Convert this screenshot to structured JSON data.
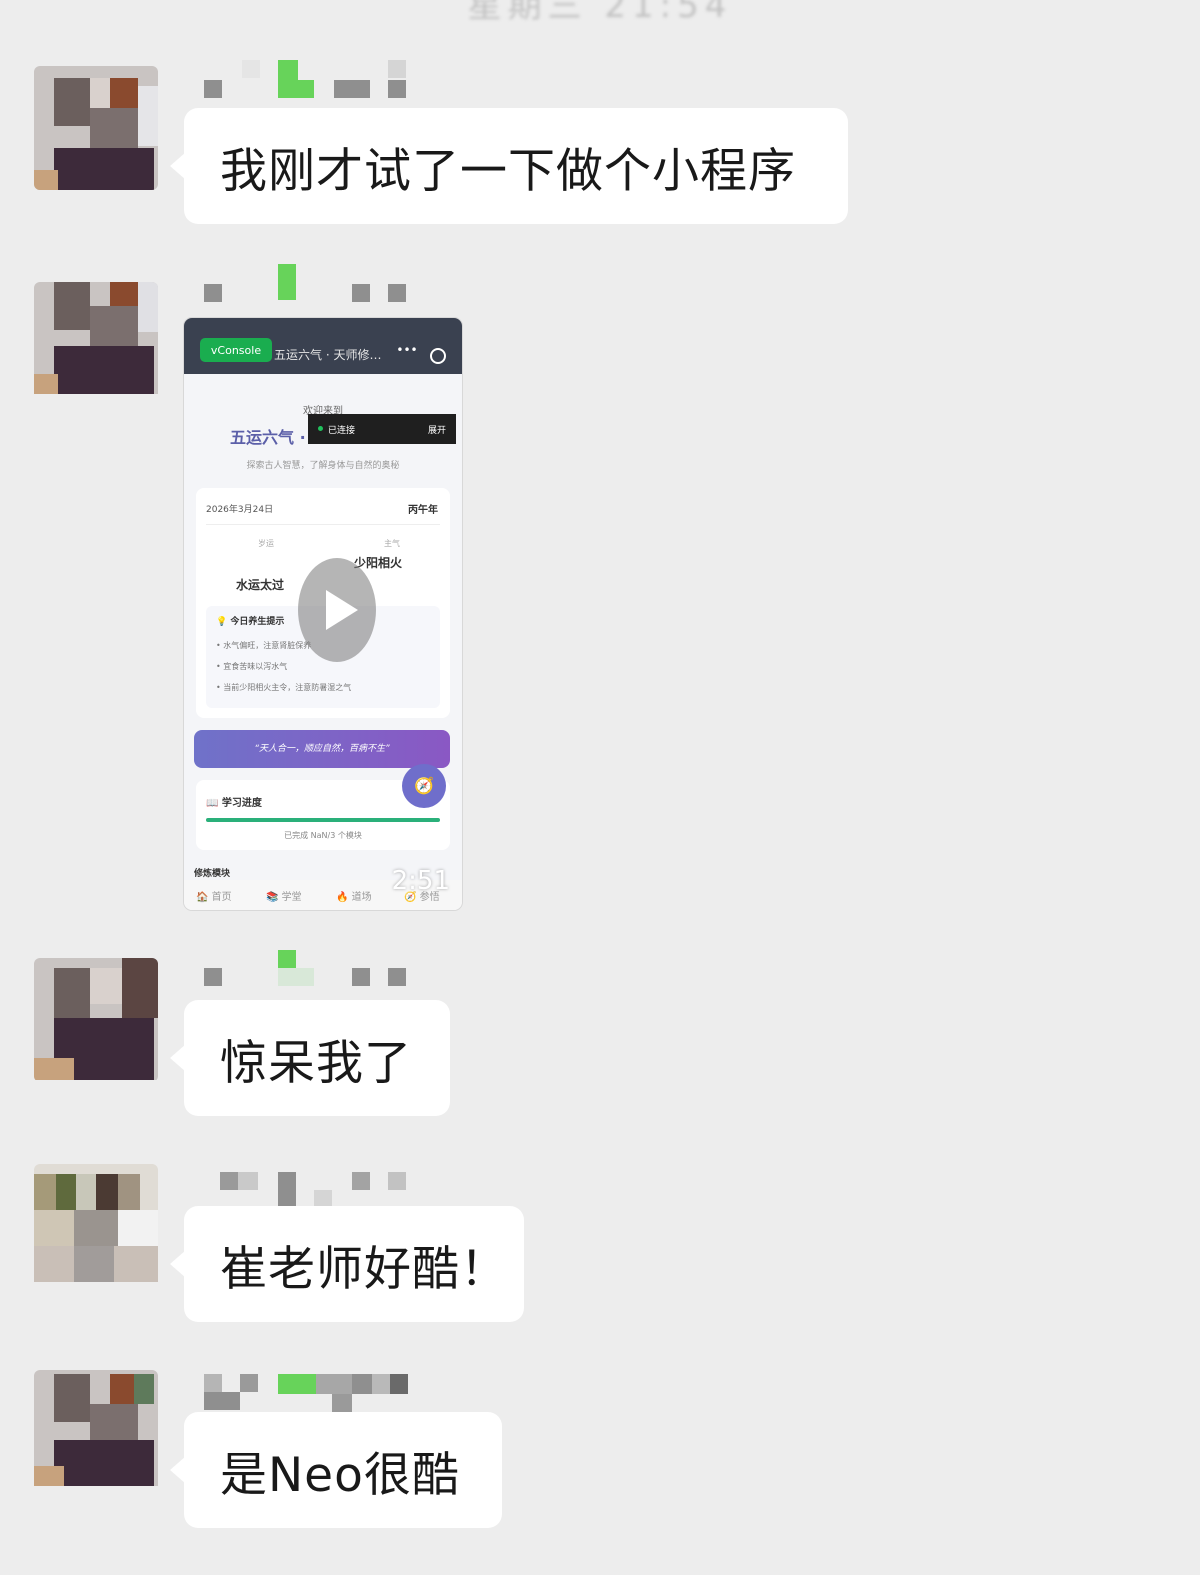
{
  "header": {
    "time_separator": "星期三 21:54"
  },
  "messages": [
    {
      "type": "text",
      "text": "我刚才试了一下做个小程序"
    },
    {
      "type": "video",
      "duration": "2:51",
      "mini_program": {
        "vconsole": "vConsole",
        "title": "五运六气 · 天师修…",
        "menu": "•••",
        "connected": "已连接",
        "expand": "展开",
        "welcome": "欢迎来到",
        "app_title": "五运六气 · ",
        "subtitle": "探索古人智慧，了解身体与自然的奥秘",
        "date": "2026年3月24日",
        "year": "丙午年",
        "label_suiyun": "岁运",
        "label_siqi": "主气",
        "siqi": "少阳相火",
        "suiyun": "水运太过",
        "tips_title": "💡 今日养生提示",
        "tips": [
          "• 水气偏旺，注意肾脏保养",
          "• 宜食苦味以泻水气",
          "• 当前少阳相火主令，注意防暑湿之气"
        ],
        "quote": "“天人合一，顺应自然，百病不生”",
        "progress_title": "📖 学习进度",
        "progress_text": "已完成 NaN/3 个模块",
        "next_section": "修炼模块",
        "nav": [
          "🏠 首页",
          "📚 学堂",
          "🔥 道场",
          "🧭 参悟"
        ],
        "compass": "🧭"
      }
    },
    {
      "type": "text",
      "text": "惊呆我了"
    },
    {
      "type": "text",
      "text": "崔老师好酷！"
    },
    {
      "type": "text",
      "text": "是Neo很酷"
    }
  ],
  "colors": {
    "background": "#ededed",
    "bubble": "#ffffff",
    "text": "#191919",
    "quote_gradient_start": "#6f72c9",
    "quote_gradient_end": "#8a58c4"
  }
}
